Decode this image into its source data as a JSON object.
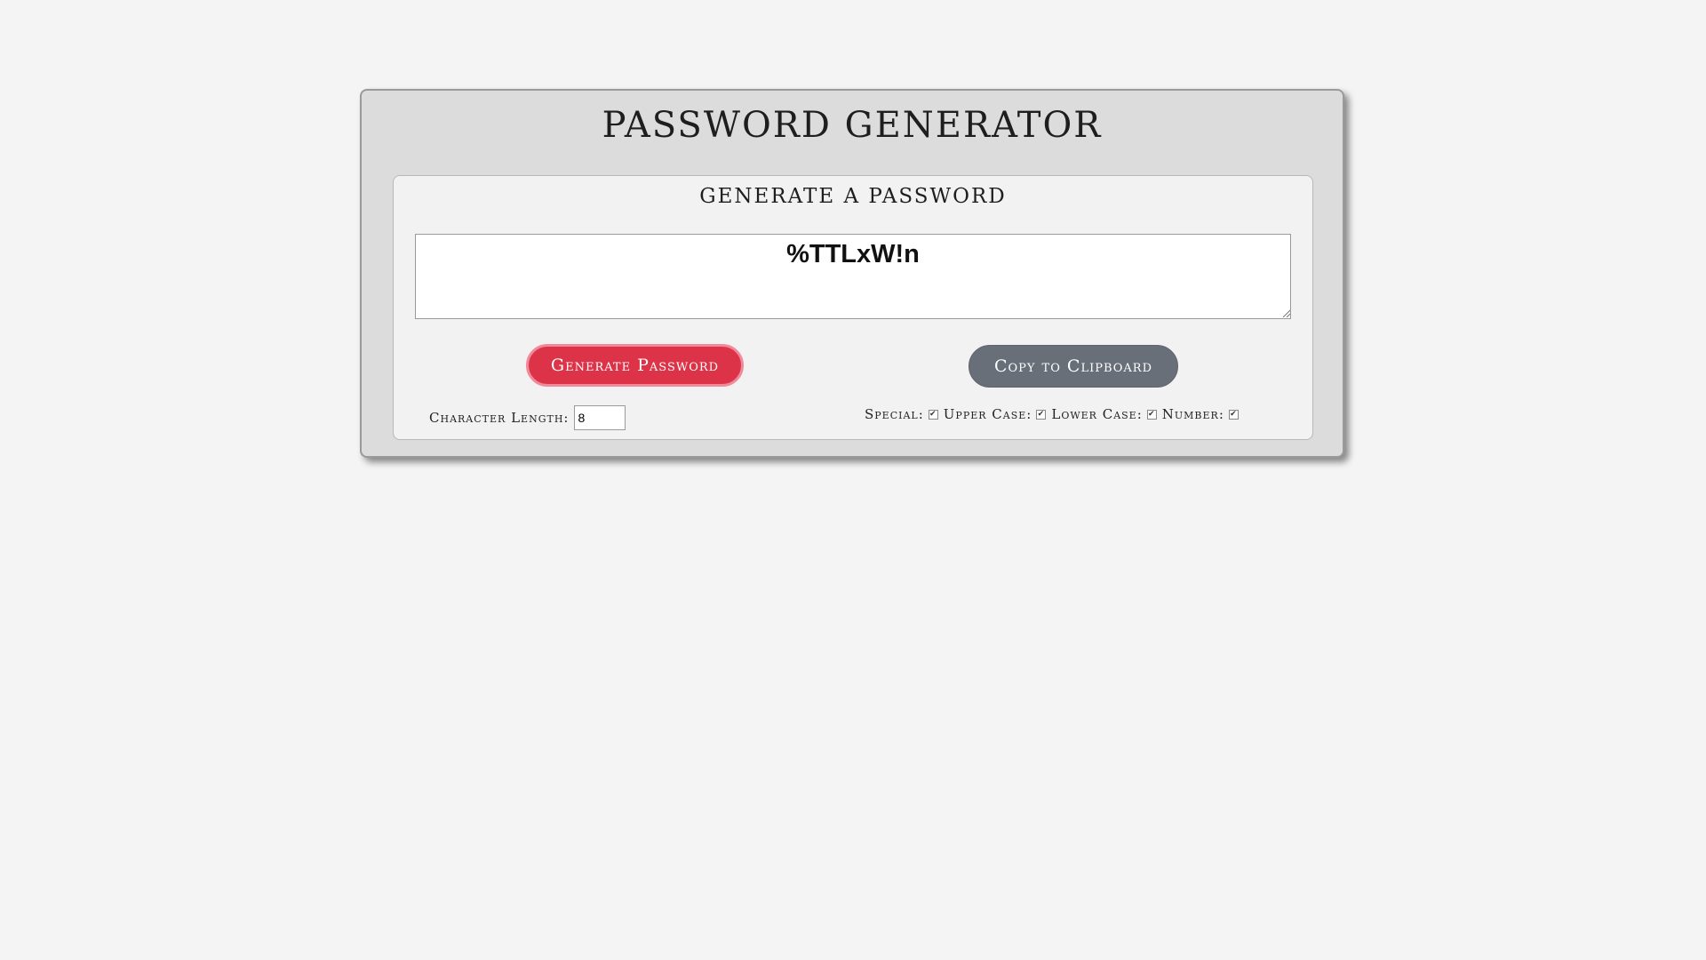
{
  "header": {
    "title": "PASSWORD GENERATOR"
  },
  "panel": {
    "title": "GENERATE A PASSWORD",
    "password_value": "%TTLxW!n"
  },
  "buttons": {
    "generate_label": "Generate Password",
    "copy_label": "Copy to Clipboard"
  },
  "length": {
    "label": "Character Length:",
    "value": "8"
  },
  "options": [
    {
      "label": "Special:",
      "checked": true
    },
    {
      "label": "Upper Case:",
      "checked": true
    },
    {
      "label": "Lower Case:",
      "checked": true
    },
    {
      "label": "Number:",
      "checked": true
    }
  ],
  "icons": {
    "checkmark": "checkbox-check-icon",
    "resize": "resize-grip-icon"
  },
  "colors": {
    "page_bg": "#f4f4f4",
    "card_bg": "#dcdcdc",
    "generate_button": "#dc3348",
    "copy_button": "#686f78"
  }
}
